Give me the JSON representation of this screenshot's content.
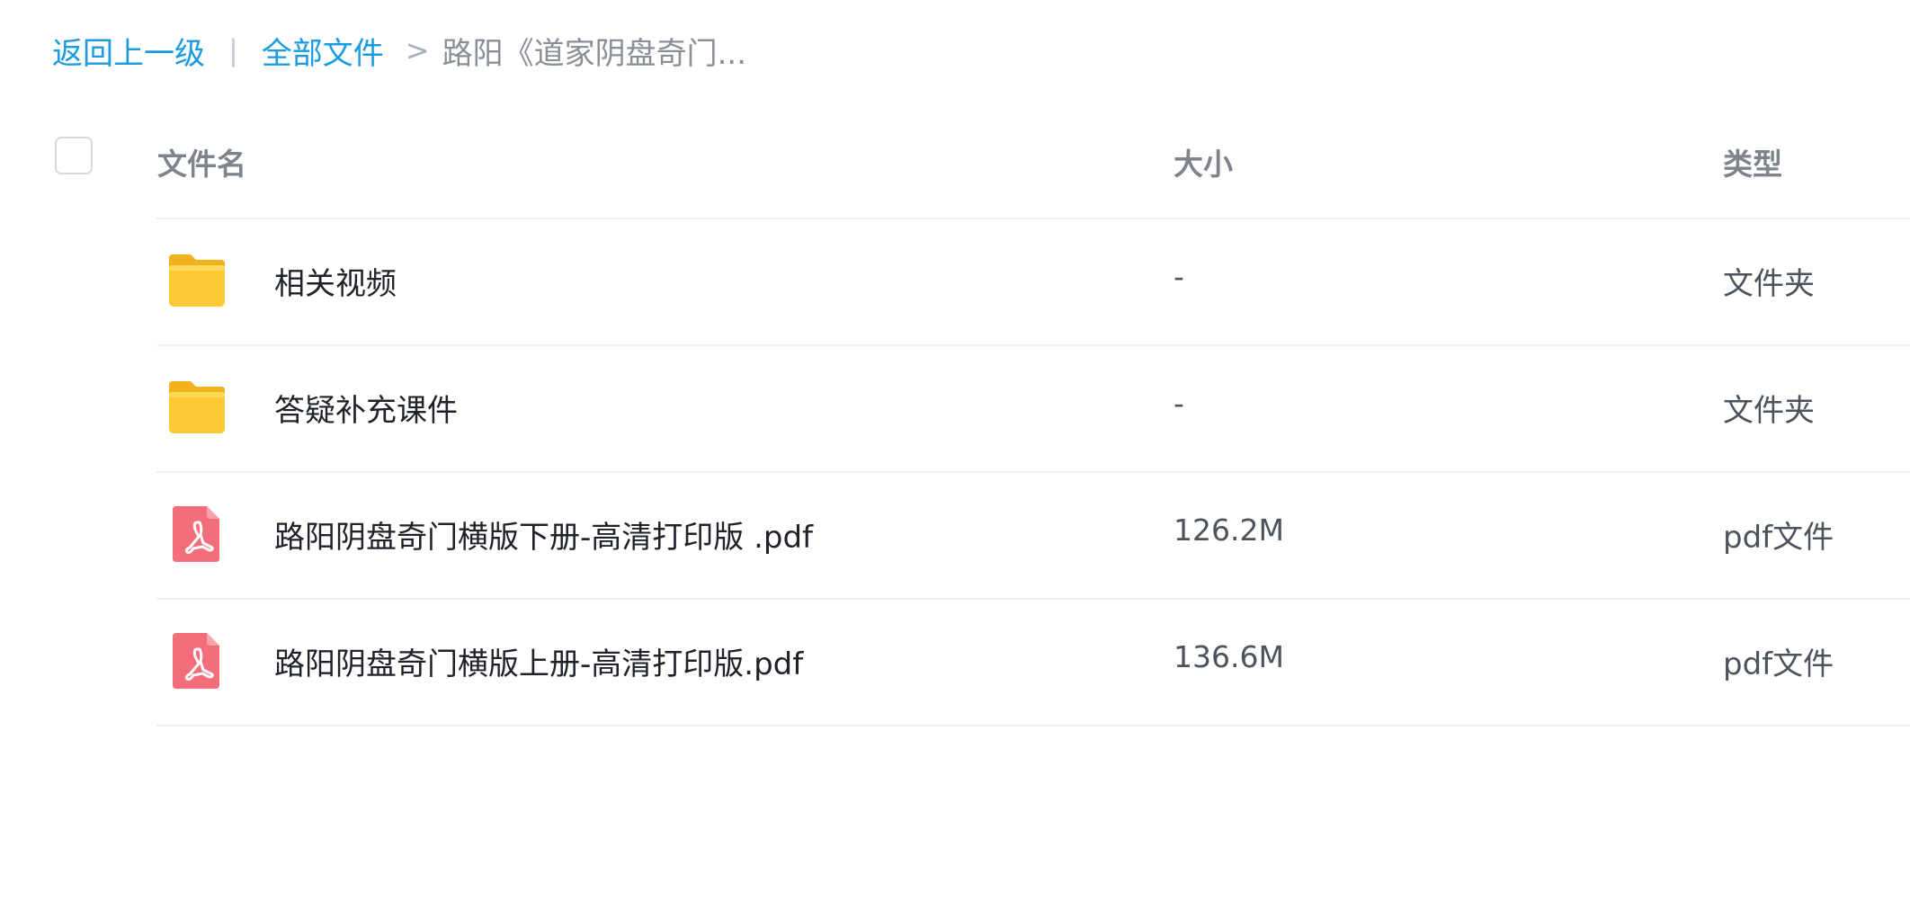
{
  "breadcrumb": {
    "back": "返回上一级",
    "separator": "|",
    "all_files": "全部文件",
    "arrow": ">",
    "current": "路阳《道家阴盘奇门..."
  },
  "table": {
    "headers": {
      "name": "文件名",
      "size": "大小",
      "type": "类型"
    },
    "rows": [
      {
        "icon": "folder-icon",
        "name": "相关视频",
        "size": "-",
        "type": "文件夹"
      },
      {
        "icon": "folder-icon",
        "name": "答疑补充课件",
        "size": "-",
        "type": "文件夹"
      },
      {
        "icon": "pdf-icon",
        "name": "路阳阴盘奇门横版下册-高清打印版 .pdf",
        "size": "126.2M",
        "type": "pdf文件"
      },
      {
        "icon": "pdf-icon",
        "name": "路阳阴盘奇门横版上册-高清打印版.pdf",
        "size": "136.6M",
        "type": "pdf文件"
      }
    ]
  },
  "colors": {
    "link": "#1a9be0",
    "folder": "#ffc933",
    "pdf": "#f46d7a"
  }
}
